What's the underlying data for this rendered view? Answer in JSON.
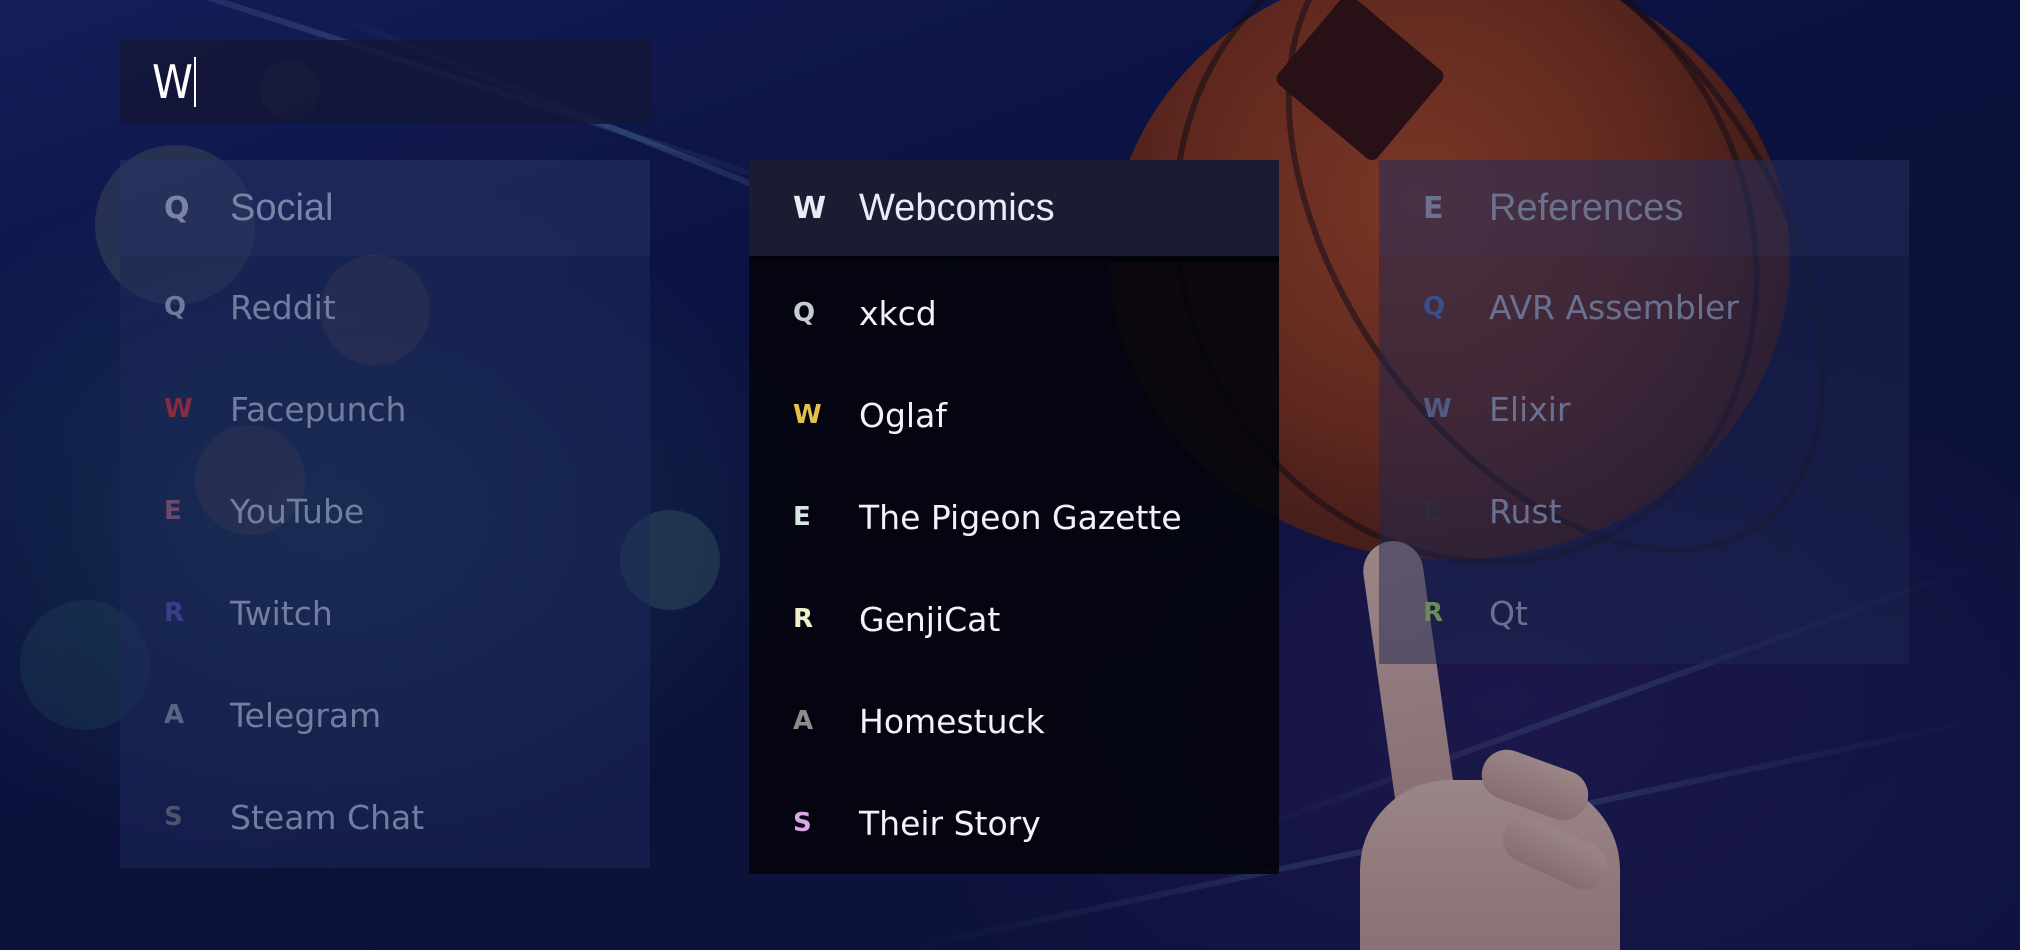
{
  "search": {
    "query": "W"
  },
  "groups": [
    {
      "key": "Q",
      "title": "Social",
      "items": [
        {
          "key": "Q",
          "label": "Reddit",
          "key_color": "#6f7a98"
        },
        {
          "key": "W",
          "label": "Facepunch",
          "key_color": "#8a2a3e"
        },
        {
          "key": "E",
          "label": "YouTube",
          "key_color": "#6c4a6a"
        },
        {
          "key": "R",
          "label": "Twitch",
          "key_color": "#3c3c8a"
        },
        {
          "key": "A",
          "label": "Telegram",
          "key_color": "#5a6488"
        },
        {
          "key": "S",
          "label": "Steam Chat",
          "key_color": "#4c5470"
        }
      ]
    },
    {
      "key": "W",
      "title": "Webcomics",
      "items": [
        {
          "key": "Q",
          "label": "xkcd",
          "key_color": "#c9cbd4"
        },
        {
          "key": "W",
          "label": "Oglaf",
          "key_color": "#e2c24a"
        },
        {
          "key": "E",
          "label": "The Pigeon Gazette",
          "key_color": "#d8e6e4"
        },
        {
          "key": "R",
          "label": "GenjiCat",
          "key_color": "#f2f0c6"
        },
        {
          "key": "A",
          "label": "Homestuck",
          "key_color": "#8c8c8c"
        },
        {
          "key": "S",
          "label": "Their Story",
          "key_color": "#d9a8e6"
        }
      ]
    },
    {
      "key": "E",
      "title": "References",
      "items": [
        {
          "key": "Q",
          "label": "AVR Assembler",
          "key_color": "#36508c"
        },
        {
          "key": "W",
          "label": "Elixir",
          "key_color": "#515a80"
        },
        {
          "key": "E",
          "label": "Rust",
          "key_color": "#2e2c40"
        },
        {
          "key": "R",
          "label": "Qt",
          "key_color": "#6e8a58"
        }
      ]
    }
  ]
}
